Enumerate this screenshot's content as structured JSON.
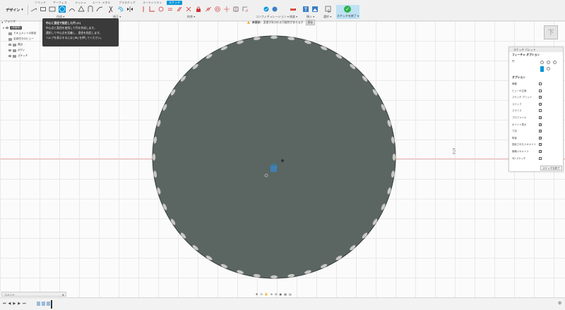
{
  "workspace": {
    "label": "デザイン"
  },
  "tabs": [
    {
      "label": "ソリッド"
    },
    {
      "label": "サーフェス"
    },
    {
      "label": "メッシュ"
    },
    {
      "label": "シート メタル"
    },
    {
      "label": "プラスチック"
    },
    {
      "label": "ユーティリティ"
    },
    {
      "label": "スケッチ",
      "active": true
    }
  ],
  "tool_groups": {
    "create": "作成",
    "modify": "修正",
    "constraints": "拘束",
    "configure": "コンフィギュレーション",
    "inspect": "検査",
    "insert": "挿入",
    "select": "選択",
    "finish": "スケッチを終了"
  },
  "browser": {
    "title": "ブラウザ",
    "items": [
      {
        "label": "(未保存)"
      },
      {
        "label": "ドキュメントの設定"
      },
      {
        "label": "名前付きのビュー"
      },
      {
        "label": "原点"
      },
      {
        "label": "ボディ"
      },
      {
        "label": "スケッチ"
      }
    ]
  },
  "tooltip": {
    "lines": [
      "中心と直径で指定した円 (C)",
      "中心点と直径を使用して円を作成します。",
      "選択して中心点を定義し、直径を指定します。",
      "ヘルプを表示するには [⌘] を押してください。"
    ]
  },
  "warning": {
    "label": "未保存:",
    "text": "変更が失われる可能性があります",
    "action": "保存"
  },
  "viewcube": {
    "face": "下"
  },
  "sketch_palette": {
    "title": "スケッチ パレット",
    "feature_options": "フィーチャ オプション",
    "circle_label": "円",
    "options_title": "オプション",
    "options": [
      {
        "label": "線種",
        "checked": false
      },
      {
        "label": "ビューの正面",
        "checked": false
      },
      {
        "label": "スケッチ グリッド",
        "checked": true
      },
      {
        "label": "スナップ",
        "checked": true
      },
      {
        "label": "スライス",
        "checked": false
      },
      {
        "label": "プロファイル",
        "checked": true
      },
      {
        "label": "ポイント表示",
        "checked": true
      },
      {
        "label": "寸法",
        "checked": true
      },
      {
        "label": "拘束",
        "checked": true
      },
      {
        "label": "投影されたジオメトリ",
        "checked": true
      },
      {
        "label": "構築ジオメトリ",
        "checked": true
      },
      {
        "label": "3D スケッチ",
        "checked": false
      }
    ],
    "finish_button": "スケッチを終了"
  },
  "canvas": {
    "dimension_label": "47.6"
  },
  "comments": {
    "label": "コメント"
  },
  "colors": {
    "accent": "#0696d7",
    "disc": "#5b6663",
    "finish_green": "#2db24a"
  }
}
